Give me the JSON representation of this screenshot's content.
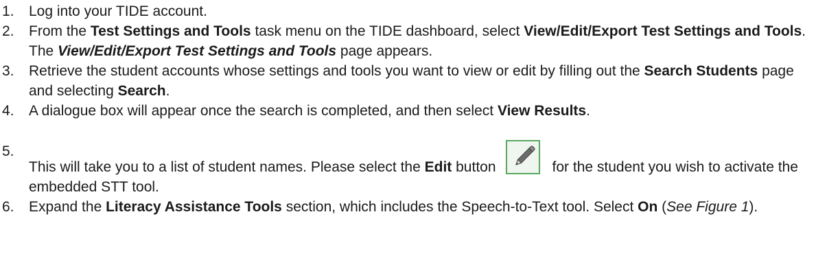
{
  "steps": [
    {
      "num": "1.",
      "parts": [
        "Log into your TIDE account."
      ]
    },
    {
      "num": "2.",
      "parts": [
        "From the ",
        "Test Settings and Tools",
        " task menu on the TIDE dashboard, select ",
        "View/Edit/Export Test Settings and Tools",
        ". The ",
        "View/Edit/Export Test Settings and Tools",
        " page appears."
      ]
    },
    {
      "num": "3.",
      "parts": [
        "Retrieve the student accounts whose settings and tools you want to view or edit by filling out the ",
        "Search Students",
        " page and selecting ",
        "Search",
        "."
      ]
    },
    {
      "num": "4.",
      "parts": [
        "A dialogue box will appear once the search is completed, and then select ",
        "View Results",
        "."
      ]
    },
    {
      "num": "5.",
      "parts": [
        "This will take you to a list of student names. Please select the ",
        "Edit",
        " button",
        "for the student you wish to activate the embedded STT tool."
      ],
      "icon": "edit-pencil-icon"
    },
    {
      "num": "6.",
      "parts": [
        "Expand the ",
        "Literacy Assistance Tools",
        " section, which includes the Speech-to-Text tool. Select ",
        "On",
        " (",
        "See Figure 1",
        ")."
      ]
    }
  ],
  "colors": {
    "text": "#1a1a1a",
    "icon_border": "#59a85e",
    "icon_fill": "#eef6ef",
    "pencil": "#555555"
  }
}
